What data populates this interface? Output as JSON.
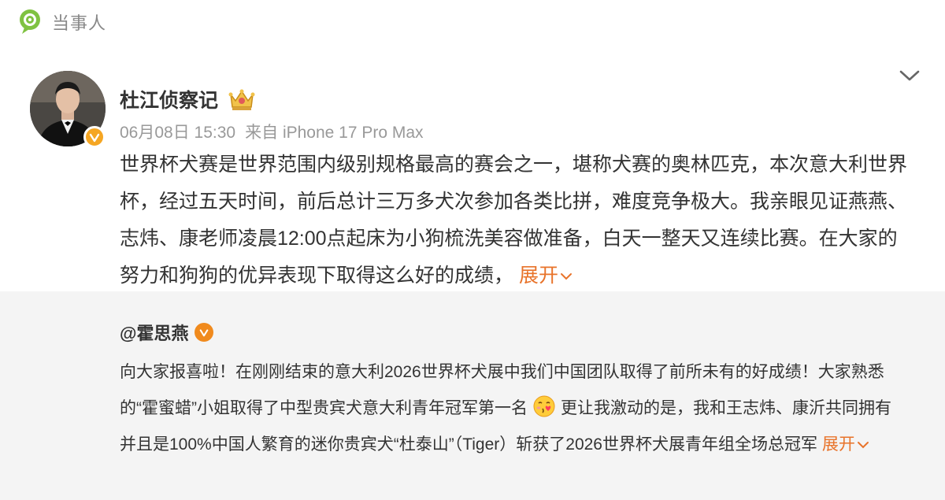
{
  "header": {
    "label": "当事人",
    "logo_icon": "weibo-party-icon"
  },
  "author": {
    "name": "杜江侦察记",
    "badge_icon": "crown-badge-icon",
    "date": "06月08日 15:30",
    "source": "来自 iPhone 17 Pro Max",
    "verified_color": "#f5a623"
  },
  "post": {
    "text": "世界杯犬赛是世界范围内级别规格最高的赛会之一，堪称犬赛的奥林匹克，本次意大利世界杯，经过五天时间，前后总计三万多犬次参加各类比拼，难度竞争极大。我亲眼见证燕燕、志炜、康老师凌晨12:00点起床为小狗梳洗美容做准备，白天一整天又连续比赛。在大家的努力和狗狗的优异表现下取得这么好的成绩，",
    "expand_label": "展开"
  },
  "retweet": {
    "author": "@霍思燕",
    "text_part1": "向大家报喜啦！在刚刚结束的意大利2026世界杯犬展中我们中国团队取得了前所未有的好成绩！大家熟悉的“霍蜜蜡”小姐取得了中型贵宾犬意大利青年冠军第一名",
    "emoji": "kiss-heart-emoji",
    "text_part2": "更让我激动的是，我和王志炜、康沂共同拥有并且是100%中国人繁育的迷你贵宾犬“杜泰山”（Tiger）斩获了2026世界杯犬展青年组全场总冠军",
    "expand_label": "展开",
    "verified_color": "#f08a1d"
  },
  "colors": {
    "accent": "#e8732a",
    "meta": "#999999",
    "retweet_bg": "#f4f4f4"
  }
}
